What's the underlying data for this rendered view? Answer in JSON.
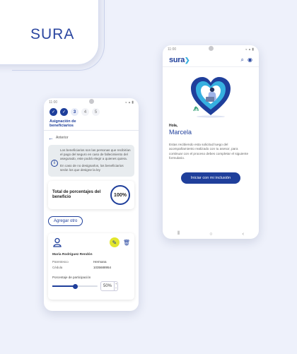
{
  "brand": {
    "title": "SURA"
  },
  "left_phone": {
    "status_time": "11:00",
    "steps": [
      "3",
      "4",
      "5"
    ],
    "tab_title": "Asignación de beneficiarios",
    "back_label": "Anterior",
    "info_text_1": "Los beneficiarios son las personas que recibirían el pago del seguro en caso de fallecimiento del asegurado, este podrá elegir a quienes quiera.",
    "info_text_2": "En caso de no designarlos, los beneficiarios serán los que designe la ley",
    "total_label": "Total de porcentajes del beneficio",
    "total_value": "100%",
    "add_button": "Agregar otro",
    "beneficiary": {
      "name": "María Rodríguez Rendón",
      "relation_label": "Parentesco",
      "relation_value": "Hermana",
      "id_label": "Cédula",
      "id_value": "1035688954",
      "percent_label": "Porcentaje de participación",
      "percent_value": "50%",
      "slider_fraction": 0.5
    }
  },
  "right_phone": {
    "status_time": "11:00",
    "logo_text": "sura",
    "greeting": "Hola,",
    "name": "Marcela",
    "description": "Estas recibiendo esta solicitud luego del acompañamiento realizado con tu asesor, para continuar con el proceso debes completar el siguiente formulario.",
    "cta_label": "Iniciar con mi inclusión"
  },
  "colors": {
    "primary": "#1f3f9b",
    "accent": "#e2e62c",
    "sky": "#36b0e0"
  }
}
